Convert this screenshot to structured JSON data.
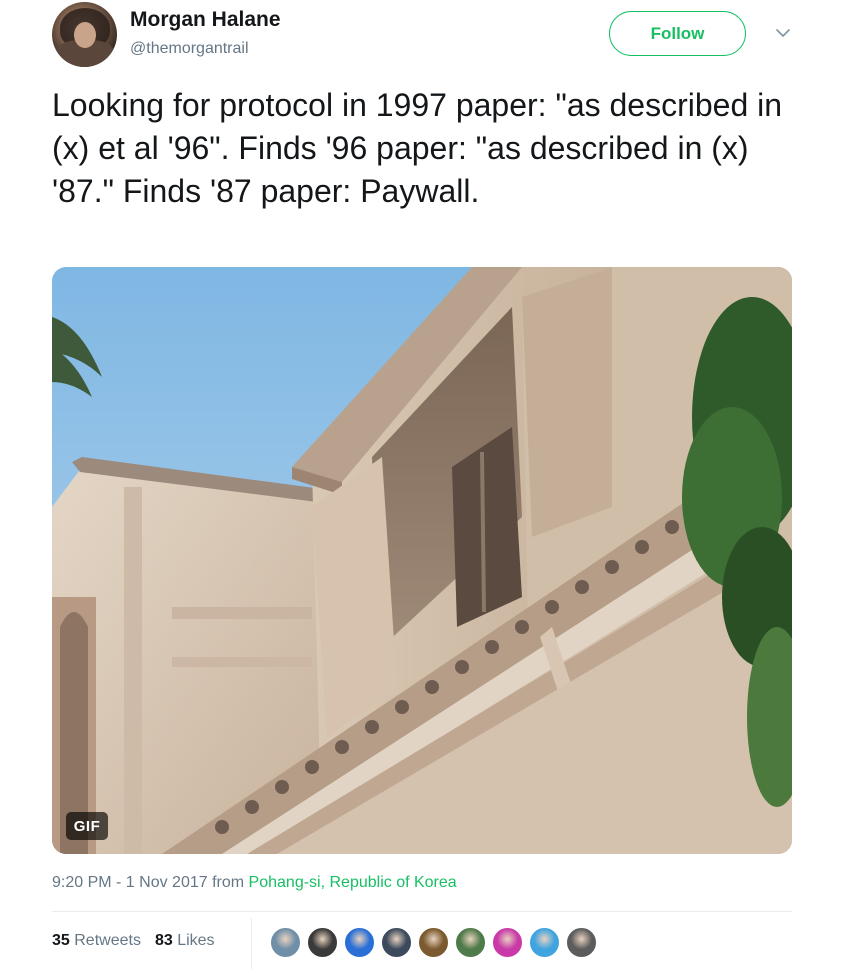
{
  "tweet": {
    "author_name": "Morgan Halane",
    "author_handle": "@themorgantrail",
    "follow_label": "Follow",
    "text": "Looking for protocol in 1997 paper: \"as described in (x) et al '96\". Finds '96 paper: \"as described in (x) '87.\" Finds '87 paper: Paywall.",
    "media_badge": "GIF",
    "time": "9:20 PM - 1 Nov 2017",
    "from_label": "from",
    "location": "Pohang-si, Republic of Korea",
    "retweets_count": "35",
    "retweets_label": "Retweets",
    "likes_count": "83",
    "likes_label": "Likes"
  },
  "colors": {
    "accent": "#17bf63",
    "muted": "#657786",
    "text": "#14171a"
  },
  "icons": {
    "caret": "chevron-down-icon"
  },
  "likers": [
    {
      "color": "#6f8fa8"
    },
    {
      "color": "#3a3a3a"
    },
    {
      "color": "#2a6fd6"
    },
    {
      "color": "#3c4a5c"
    },
    {
      "color": "#7a5a2e"
    },
    {
      "color": "#4f7a4a"
    },
    {
      "color": "#c93aa8"
    },
    {
      "color": "#3fa4e0"
    },
    {
      "color": "#5c5c5c"
    }
  ]
}
